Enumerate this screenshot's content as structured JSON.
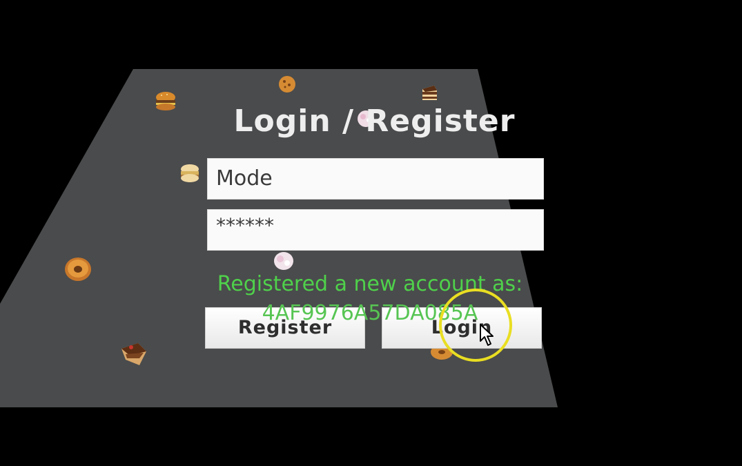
{
  "title": "Login / Register",
  "username_field": {
    "value": "Mode"
  },
  "password_field": {
    "value": "******"
  },
  "status": {
    "line1": "Registered a new account as:",
    "line2": "4AF9976A57DA085A"
  },
  "buttons": {
    "register": "Register",
    "login": "Login"
  },
  "colors": {
    "background": "#000000",
    "floor": "#4a4b4c",
    "status_text": "#4fd14b",
    "highlight_ring": "#e9de22"
  },
  "icons": [
    "burger-icon",
    "cookie-icon",
    "cake-slice-icon",
    "sandwich-icon",
    "donut-icon",
    "cupcake-icon",
    "pointer-cursor-icon"
  ]
}
